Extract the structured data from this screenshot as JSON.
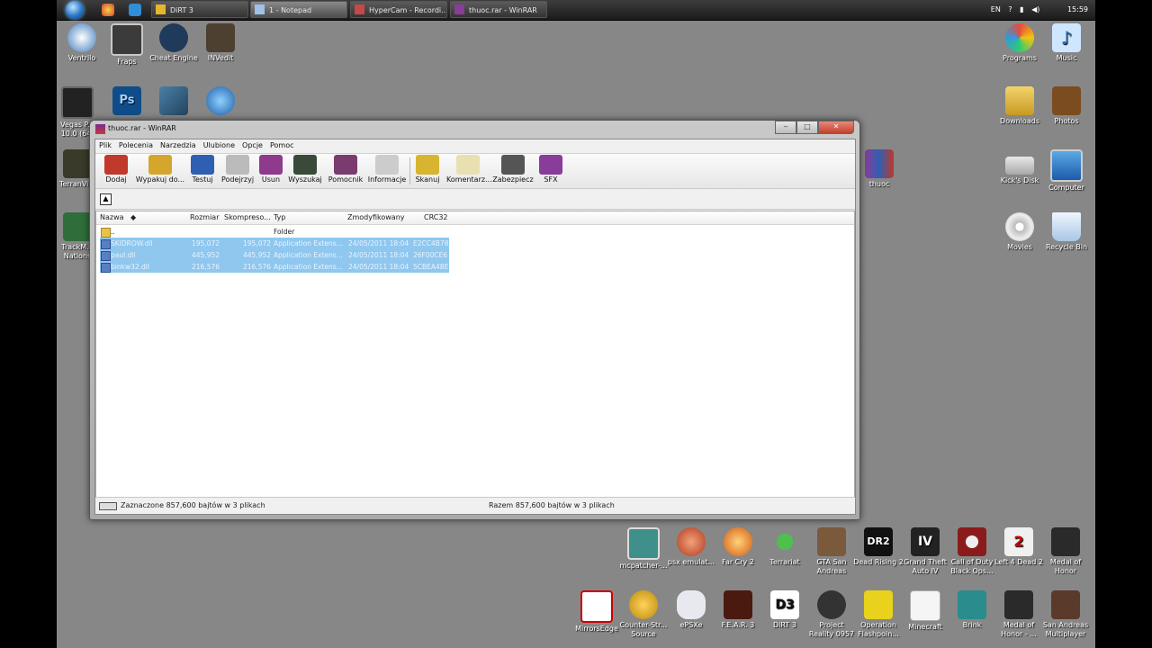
{
  "taskbar": {
    "tasks": [
      {
        "label": "DiRT 3",
        "active": false
      },
      {
        "label": "1 - Notepad",
        "active": true
      },
      {
        "label": "HyperCam - Recordi...",
        "active": false
      },
      {
        "label": "thuoc.rar - WinRAR",
        "active": false
      }
    ],
    "tray": {
      "lang": "EN",
      "clock": "15:59"
    }
  },
  "desktop_icons": {
    "ventrilo": "Ventrilo",
    "fraps": "Fraps",
    "cheat_engine": "Cheat Engine",
    "invedit": "INVedit",
    "vegas": "Vegas P... 10.0 (64-",
    "terranvi": "TerranVi...",
    "trackmania": "TrackM... Nations",
    "programs": "Programs",
    "music": "Music",
    "downloads": "Downloads",
    "photos": "Photos",
    "thuoc": "thuoc",
    "kicks_disk": "Kick's Disk",
    "computer": "Computer",
    "movies": "Movies",
    "recycle_bin": "Recycle Bin",
    "mcpatcher": "mcpatcher-...",
    "psx": "psx emulat...",
    "farcry2": "Far Cry 2",
    "terrariat": "Terrariat",
    "gta_sa": "GTA San Andreas",
    "dead_rising2": "Dead Rising 2",
    "gta4": "Grand Theft Auto IV",
    "cod_bo": "Call of Duty Black Ops...",
    "l4d2": "Left 4 Dead 2",
    "moh": "Medal of Honor",
    "mirrors_edge": "MirrorsEdge",
    "css": "Counter-Str... Source",
    "epsxe": "ePSXe",
    "fear3": "F.E.A.R. 3",
    "dirt3": "DiRT 3",
    "project_reality": "Project Reality 0957",
    "op_flashpoint": "Operation Flashpoin...",
    "minecraft": "Minecraft",
    "brink": "Brink",
    "moh2": "Medal of Honor - ...",
    "samp": "San Andreas Multiplayer"
  },
  "window": {
    "title": "thuoc.rar - WinRAR",
    "minimize": "‒",
    "maximize": "□",
    "close": "✕"
  },
  "menu": [
    "Plik",
    "Polecenia",
    "Narzedzia",
    "Ulubione",
    "Opcje",
    "Pomoc"
  ],
  "toolbar": [
    {
      "label": "Dodaj",
      "color": "#c0392b"
    },
    {
      "label": "Wypakuj do...",
      "color": "#d4a72c"
    },
    {
      "label": "Testuj",
      "color": "#2f5fb3"
    },
    {
      "label": "Podejrzyj",
      "color": "#bbbbbb"
    },
    {
      "label": "Usun",
      "color": "#8e3b8e"
    },
    {
      "label": "Wyszukaj",
      "color": "#3a4a3a"
    },
    {
      "label": "Pomocnik",
      "color": "#7a3c6e"
    },
    {
      "label": "Informacje",
      "color": "#cccccc"
    },
    {
      "label": "Skanuj",
      "color": "#d8b430"
    },
    {
      "label": "Komentarz...",
      "color": "#e8e0b0"
    },
    {
      "label": "Zabezpiecz",
      "color": "#555555"
    },
    {
      "label": "SFX",
      "color": "#8a3c9a"
    }
  ],
  "columns": [
    "Nazwa",
    "Rozmiar",
    "Skompreso...",
    "Typ",
    "Zmodyfikowany",
    "CRC32"
  ],
  "rows": [
    {
      "name": "..",
      "size": "",
      "packed": "",
      "type": "Folder",
      "modified": "",
      "crc": "",
      "selected": false,
      "folder": true
    },
    {
      "name": "SKIDROW.dll",
      "size": "195,072",
      "packed": "195,072",
      "type": "Application Extens...",
      "modified": "24/05/2011 18:04",
      "crc": "E2CC4B78",
      "selected": true,
      "folder": false
    },
    {
      "name": "paul.dll",
      "size": "445,952",
      "packed": "445,952",
      "type": "Application Extens...",
      "modified": "24/05/2011 18:04",
      "crc": "26F00CE6",
      "selected": true,
      "folder": false
    },
    {
      "name": "binkw32.dll",
      "size": "216,576",
      "packed": "216,576",
      "type": "Application Extens...",
      "modified": "24/05/2011 18:04",
      "crc": "5CBEA48E",
      "selected": true,
      "folder": false
    }
  ],
  "status": {
    "selected": "Zaznaczone 857,600 bajtów w 3 plikach",
    "total": "Razem 857,600 bajtów w 3 plikach"
  }
}
